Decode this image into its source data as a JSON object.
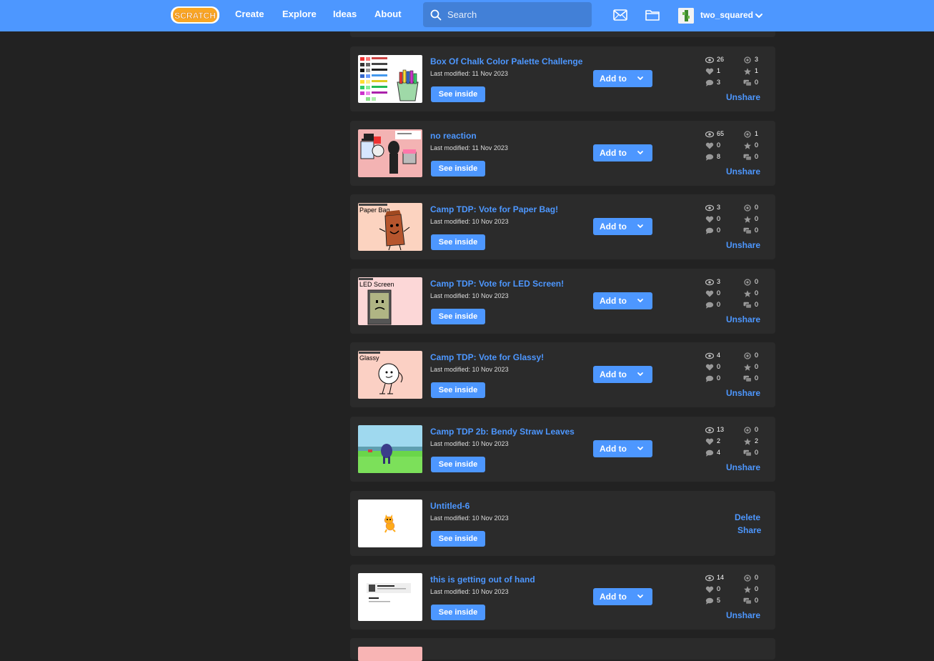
{
  "nav": {
    "create": "Create",
    "explore": "Explore",
    "ideas": "Ideas",
    "about": "About",
    "search_placeholder": "Search",
    "username": "two_squared",
    "logo_text": "SCRATCH"
  },
  "colors": {
    "brand_blue": "#4d97ff",
    "background": "#222222",
    "card": "#2b2b2b"
  },
  "buttons": {
    "see_inside": "See inside",
    "add_to": "Add to",
    "unshare": "Unshare",
    "delete": "Delete",
    "share": "Share"
  },
  "projects": [
    {
      "title": "Box Of Chalk Color Palette Challenge",
      "modified": "Last modified: 11 Nov 2023",
      "thumb": "chalk",
      "views": "26",
      "remixes": "3",
      "loves": "1",
      "favorites": "1",
      "comments": "3",
      "studios": "0",
      "shared": true
    },
    {
      "title": "no reaction",
      "modified": "Last modified: 11 Nov 2023",
      "thumb": "reaction",
      "views": "65",
      "remixes": "1",
      "loves": "0",
      "favorites": "0",
      "comments": "8",
      "studios": "0",
      "shared": true
    },
    {
      "title": "Camp TDP: Vote for Paper Bag!",
      "modified": "Last modified: 10 Nov 2023",
      "thumb": "paperbag",
      "thumb_label": "Paper Bag",
      "views": "3",
      "remixes": "0",
      "loves": "0",
      "favorites": "0",
      "comments": "0",
      "studios": "0",
      "shared": true
    },
    {
      "title": "Camp TDP: Vote for LED Screen!",
      "modified": "Last modified: 10 Nov 2023",
      "thumb": "led",
      "thumb_label": "LED Screen",
      "views": "3",
      "remixes": "0",
      "loves": "0",
      "favorites": "0",
      "comments": "0",
      "studios": "0",
      "shared": true
    },
    {
      "title": "Camp TDP: Vote for Glassy!",
      "modified": "Last modified: 10 Nov 2023",
      "thumb": "glassy",
      "thumb_label": "Glassy",
      "views": "4",
      "remixes": "0",
      "loves": "0",
      "favorites": "0",
      "comments": "0",
      "studios": "0",
      "shared": true
    },
    {
      "title": "Camp TDP 2b: Bendy Straw Leaves",
      "modified": "Last modified: 10 Nov 2023",
      "thumb": "field",
      "views": "13",
      "remixes": "0",
      "loves": "2",
      "favorites": "2",
      "comments": "4",
      "studios": "0",
      "shared": true
    },
    {
      "title": "Untitled-6",
      "modified": "Last modified: 10 Nov 2023",
      "thumb": "cat",
      "shared": false
    },
    {
      "title": "this is getting out of hand",
      "modified": "Last modified: 10 Nov 2023",
      "thumb": "profile",
      "views": "14",
      "remixes": "0",
      "loves": "0",
      "favorites": "0",
      "comments": "5",
      "studios": "0",
      "shared": true
    }
  ]
}
